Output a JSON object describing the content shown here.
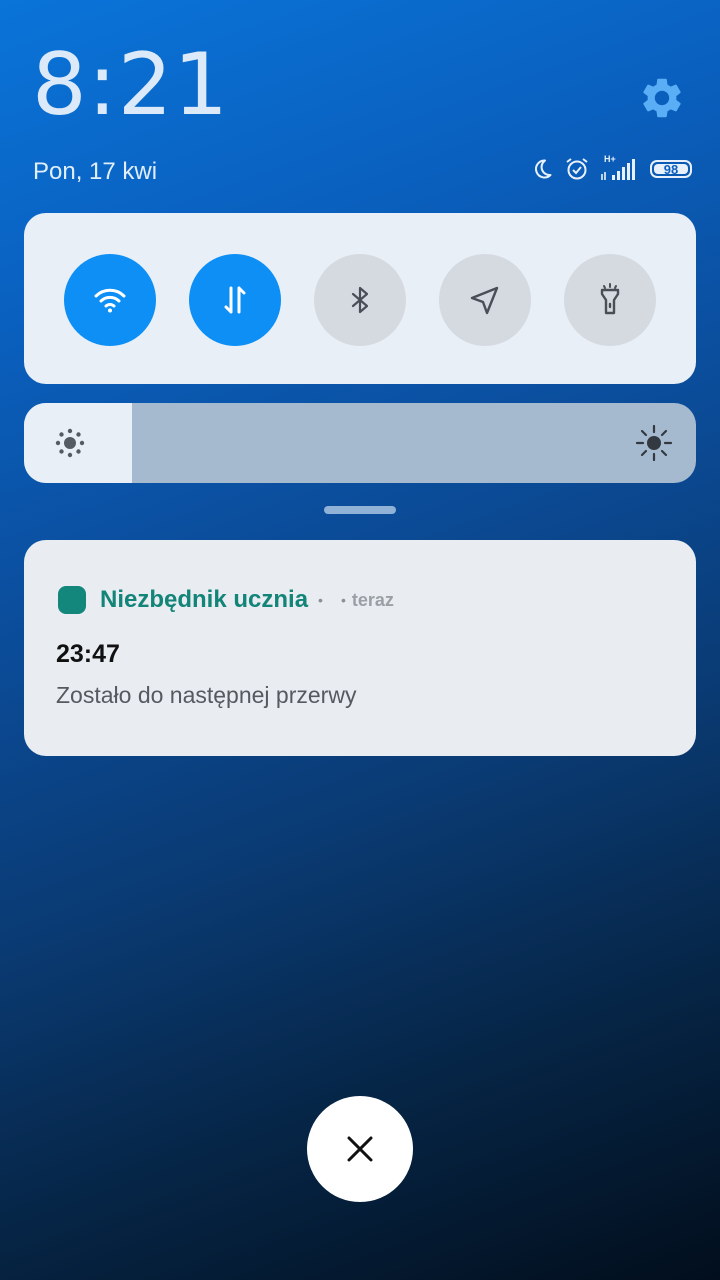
{
  "status": {
    "clock": "8:21",
    "date": "Pon, 17 kwi",
    "network_label": "H+",
    "battery": "98",
    "icons": [
      "moon-icon",
      "alarm-icon",
      "signal-icon",
      "battery-icon"
    ]
  },
  "quick_settings": {
    "toggles": [
      {
        "name": "wifi",
        "icon": "wifi-icon",
        "active": true
      },
      {
        "name": "mobile-data",
        "icon": "data-transfer-icon",
        "active": true
      },
      {
        "name": "bluetooth",
        "icon": "bluetooth-icon",
        "active": false
      },
      {
        "name": "location",
        "icon": "location-arrow-icon",
        "active": false
      },
      {
        "name": "flashlight",
        "icon": "flashlight-icon",
        "active": false
      }
    ],
    "brightness_level": 0.16,
    "colors": {
      "active": "#0d8ff5",
      "inactive": "#d5dae1",
      "panel": "#e9eff7"
    }
  },
  "notification": {
    "app_name": "Niezbędnik ucznia",
    "time": "teraz",
    "title": "23:47",
    "text": "Zostało do następnej przerwy",
    "accent": "#138478"
  }
}
